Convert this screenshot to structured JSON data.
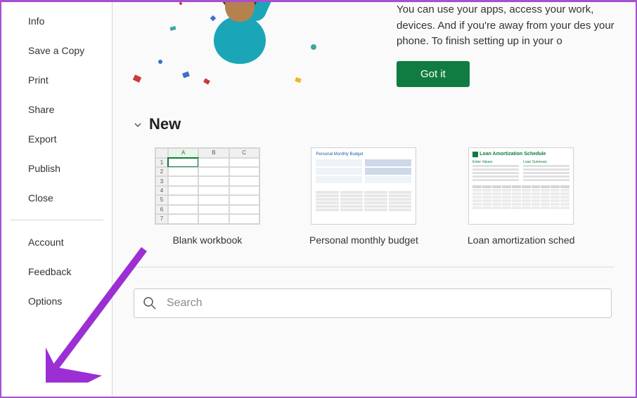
{
  "sidebar": {
    "items": [
      {
        "label": "Info"
      },
      {
        "label": "Save a Copy"
      },
      {
        "label": "Print"
      },
      {
        "label": "Share"
      },
      {
        "label": "Export"
      },
      {
        "label": "Publish"
      },
      {
        "label": "Close"
      }
    ],
    "bottom_items": [
      {
        "label": "Account"
      },
      {
        "label": "Feedback"
      },
      {
        "label": "Options"
      }
    ]
  },
  "banner": {
    "text": "You can use your apps, access your work, devices. And if you're away from your des your phone. To finish setting up in your o",
    "button": "Got it"
  },
  "section": {
    "title": "New"
  },
  "templates": [
    {
      "label": "Blank workbook"
    },
    {
      "label": "Personal monthly budget",
      "thumb_title": "Personal Monthly Budget"
    },
    {
      "label": "Loan amortization sched",
      "thumb_title": "Loan Amortization Schedule",
      "col1": "Enter Values",
      "col2": "Loan Summary"
    }
  ],
  "search": {
    "placeholder": "Search"
  },
  "colors": {
    "accent": "#107c41",
    "annotation": "#9b2fd4"
  }
}
